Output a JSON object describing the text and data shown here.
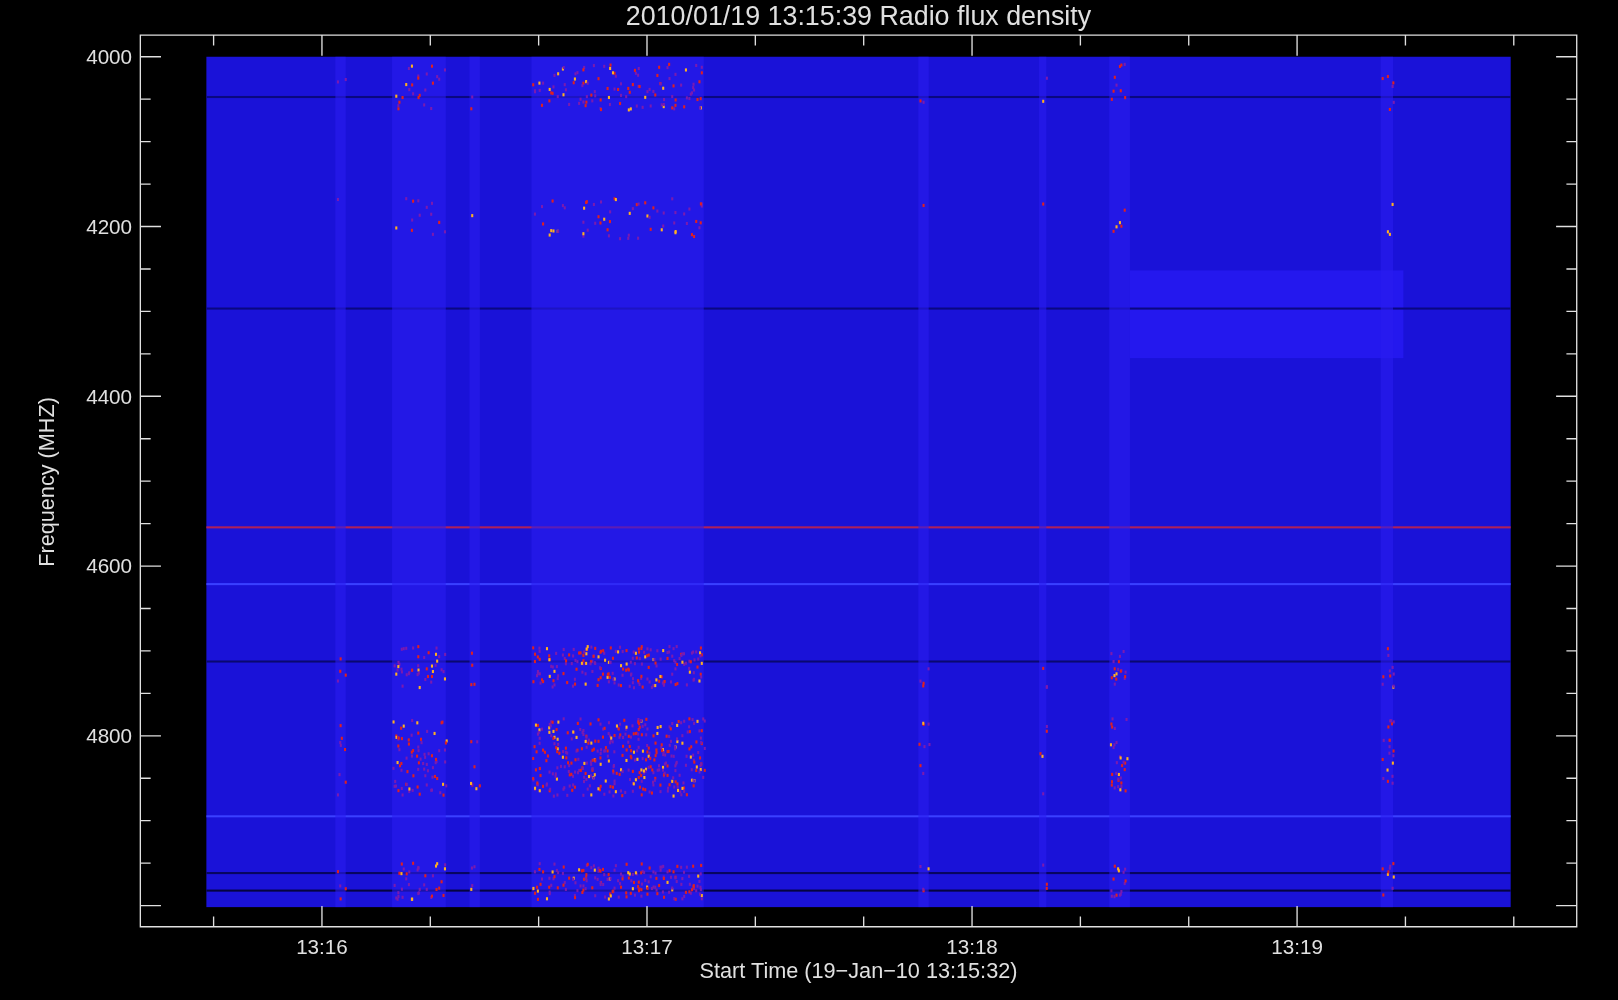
{
  "chart": {
    "title": "2010/01/19 13:15:39 Radio flux density",
    "xlabel": "Start Time (19−Jan−10 13:15:32)",
    "ylabel": "Frequency (MHZ)",
    "xticks": [
      "13:16",
      "13:17",
      "13:18",
      "13:19"
    ],
    "yticks": [
      "4000",
      "4200",
      "4400",
      "4600",
      "4800"
    ]
  }
}
